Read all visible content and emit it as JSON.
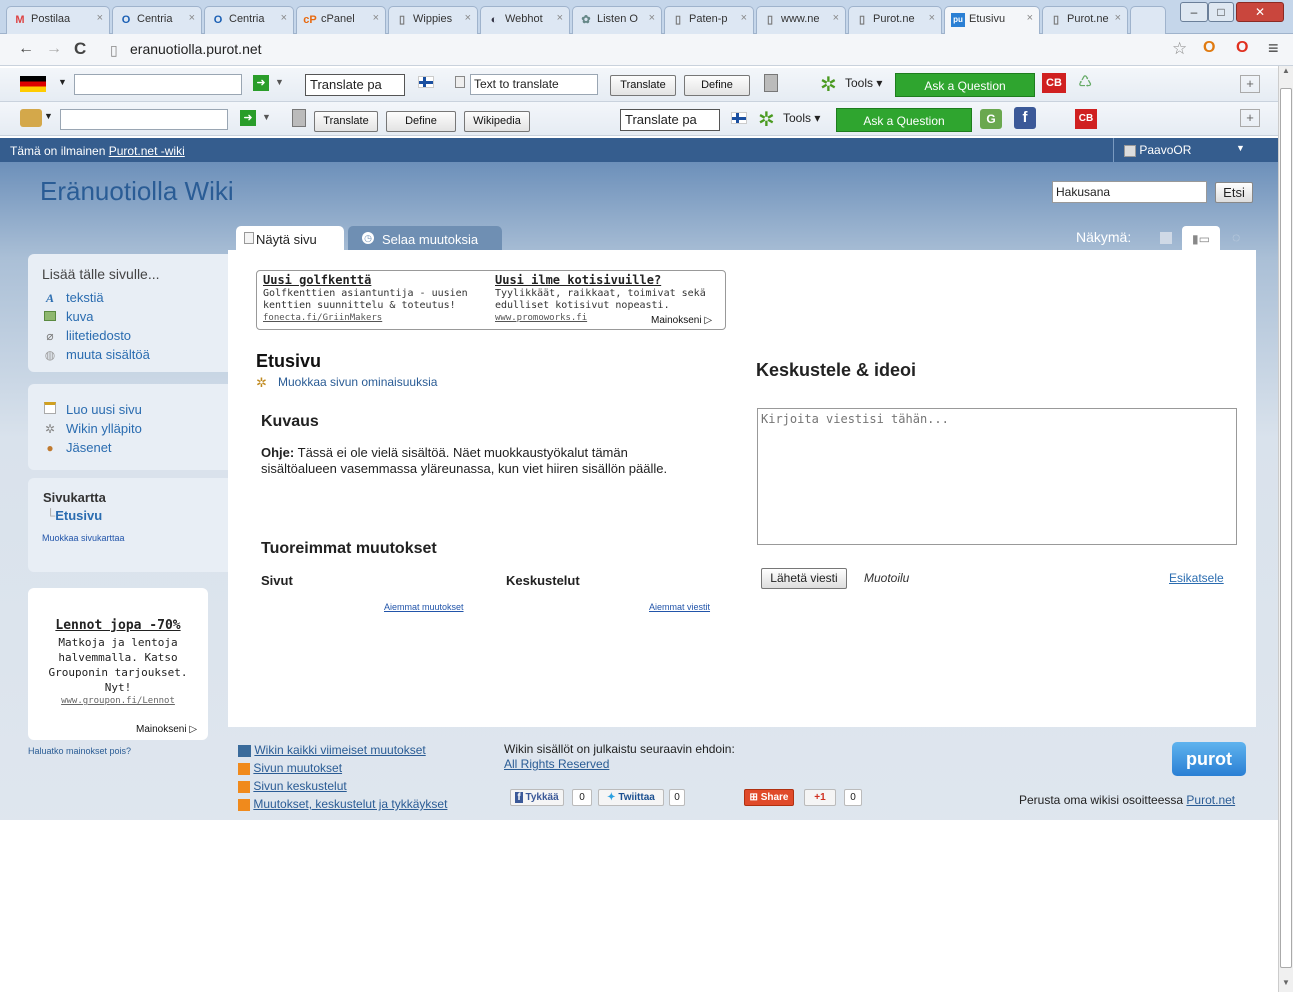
{
  "browser": {
    "tabs": [
      {
        "label": "Postilaa",
        "icon": "gmail-icon"
      },
      {
        "label": "Centria",
        "icon": "opera-icon"
      },
      {
        "label": "Centria",
        "icon": "opera-icon"
      },
      {
        "label": "cPanel",
        "icon": "cpanel-icon"
      },
      {
        "label": "Wippies",
        "icon": "page-icon"
      },
      {
        "label": "Webhot",
        "icon": "webhot-icon"
      },
      {
        "label": "Listen O",
        "icon": "listen-icon"
      },
      {
        "label": "Paten-p",
        "icon": "page-icon"
      },
      {
        "label": "www.ne",
        "icon": "page-icon"
      },
      {
        "label": "Purot.ne",
        "icon": "page-icon"
      },
      {
        "label": "Etusivu",
        "icon": "purot-icon",
        "active": true
      },
      {
        "label": "Purot.ne",
        "icon": "page-icon"
      }
    ],
    "url": "eranuotiolla.purot.net"
  },
  "toolbar1": {
    "translate_page": "Translate pa",
    "text_to_translate": "Text to translate",
    "translate_label": "Translate",
    "define_label": "Define",
    "tools_label": "Tools",
    "ask_label": "Ask a Question"
  },
  "toolbar2": {
    "translate_label": "Translate",
    "define_label": "Define",
    "wikipedia_label": "Wikipedia",
    "translate_page": "Translate pa",
    "tools_label": "Tools",
    "ask_label": "Ask a Question"
  },
  "banner": {
    "text": "Tämä on ilmainen",
    "link": "Purot.net -wiki",
    "user": "PaavoOR"
  },
  "site": {
    "title": "Eränuotiolla Wiki",
    "search_value": "Hakusana",
    "search_button": "Etsi",
    "view_label": "Näkymä:"
  },
  "page_tabs": {
    "show": "Näytä sivu",
    "changes": "Selaa muutoksia"
  },
  "sidebar": {
    "add_title": "Lisää tälle sivulle...",
    "add_items": [
      "tekstiä",
      "kuva",
      "liitetiedosto",
      "muuta sisältöä"
    ],
    "admin_items": [
      "Luo uusi sivu",
      "Wikin ylläpito",
      "Jäsenet"
    ],
    "sitemap_title": "Sivukartta",
    "sitemap_page": "Etusivu",
    "sitemap_edit": "Muokkaa sivukarttaa"
  },
  "ads": {
    "ad1_title": "Uusi golfkenttä",
    "ad1_text1": "Golfkenttien asiantuntija - uusien",
    "ad1_text2": "kenttien suunnittelu & toteutus!",
    "ad1_url": "fonecta.fi/GriinMakers",
    "ad2_title": "Uusi ilme kotisivuille?",
    "ad2_text1": "Tyylikkäät, raikkaat, toimivat sekä",
    "ad2_text2": "edulliset kotisivut nopeasti.",
    "ad2_url": "www.promoworks.fi",
    "mainokseni": "Mainokseni"
  },
  "main": {
    "page_title": "Etusivu",
    "edit_props": "Muokkaa sivun ominaisuuksia",
    "desc_title": "Kuvaus",
    "help_bold": "Ohje:",
    "help_line1": "Tässä ei ole vielä sisältöä. Näet muokkaustyökalut tämän",
    "help_line2": "sisältöalueen vasemmassa yläreunassa, kun viet hiiren sisällön päälle.",
    "recent_title": "Tuoreimmat muutokset",
    "col_pages": "Sivut",
    "col_discussions": "Keskustelut",
    "older_changes": "Aiemmat muutokset",
    "older_messages": "Aiemmat viestit"
  },
  "discussion": {
    "title": "Keskustele & ideoi",
    "placeholder": "Kirjoita viestisi tähän...",
    "send": "Lähetä viesti",
    "format": "Muotoilu",
    "preview": "Esikatsele"
  },
  "side_ad": {
    "title": "Lennot jopa -70%",
    "line1": "Matkoja ja lentoja",
    "line2": "halvemmalla. Katso",
    "line3": "Grouponin tarjoukset.",
    "line4": "Nyt!",
    "url": "www.groupon.fi/Lennot",
    "mainokseni": "Mainokseni",
    "remove_ads": "Haluatko mainokset pois?"
  },
  "footer": {
    "links": [
      "Wikin kaikki viimeiset muutokset",
      "Sivun muutokset",
      "Sivun keskustelut",
      "Muutokset, keskustelut ja tykkäykset"
    ],
    "license_text": "Wikin sisällöt on julkaistu seuraavin ehdoin:",
    "license_link": "All Rights Reserved",
    "like": "Tykkää",
    "like_count": "0",
    "tweet": "Twiittaa",
    "tweet_count": "0",
    "share": "Share",
    "gplus": "+1",
    "gplus_count": "0",
    "logo": "purot",
    "found_text": "Perusta oma wikisi osoitteessa",
    "found_link": "Purot.net"
  }
}
